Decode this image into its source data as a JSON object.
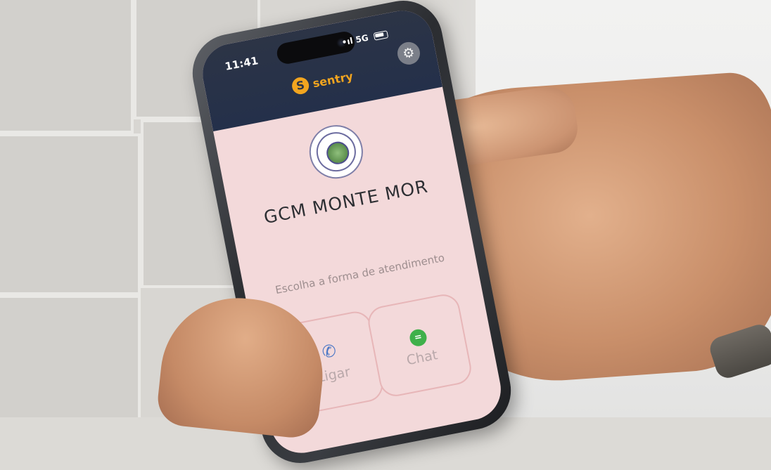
{
  "status_bar": {
    "time": "11:41",
    "network": "5G",
    "signal": "•ıl"
  },
  "app": {
    "brand_name": "sentry",
    "brand_logo_glyph": "S",
    "settings_icon": "gear-icon",
    "organization_name": "GCM MONTE MOR",
    "prompt": "Escolha a forma de atendimento",
    "options": [
      {
        "label": "Ligar",
        "icon": "phone-icon",
        "icon_glyph": "✆"
      },
      {
        "label": "Chat",
        "icon": "chat-icon",
        "icon_glyph": "="
      }
    ]
  },
  "colors": {
    "topbar": "#2c3446",
    "brand_accent": "#f2a51f",
    "screen_background": "#f3d9da",
    "call_icon": "#4e79c6",
    "chat_icon": "#3fb04a"
  }
}
